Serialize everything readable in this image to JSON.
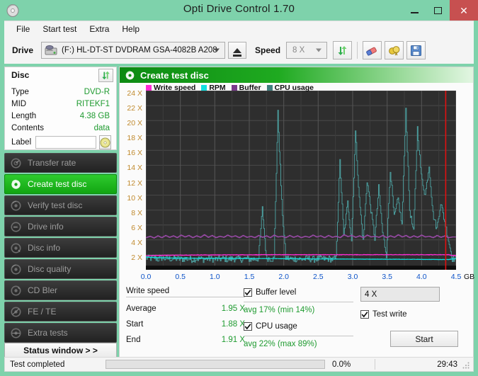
{
  "window": {
    "title": "Opti Drive Control 1.70",
    "app_icon": "disc-icon",
    "minimize_label": "",
    "maximize_label": "",
    "close_label": "✕"
  },
  "menu": {
    "items": [
      {
        "label": "File"
      },
      {
        "label": "Start test"
      },
      {
        "label": "Extra"
      },
      {
        "label": "Help"
      }
    ]
  },
  "toolbar": {
    "drive_label": "Drive",
    "drive_value": "(F:)   HL-DT-ST DVDRAM GSA-4082B A208",
    "eject_label": "eject-icon",
    "speed_label": "Speed",
    "speed_value": "8 X",
    "refresh_icon": "refresh-icon",
    "erase_icon": "eraser-icon",
    "medal_icon": "medal-icon",
    "save_icon": "floppy-save-icon"
  },
  "disc_panel": {
    "header": "Disc",
    "refresh_icon": "refresh-icon",
    "rows": [
      {
        "key": "Type",
        "value": "DVD-R"
      },
      {
        "key": "MID",
        "value": "RITEKF1"
      },
      {
        "key": "Length",
        "value": "4.38 GB"
      },
      {
        "key": "Contents",
        "value": "data"
      }
    ],
    "label_key": "Label",
    "label_value": "",
    "label_placeholder": "",
    "cd_icon": "cd-disc-icon"
  },
  "sidebar": {
    "items": [
      {
        "label": "Transfer rate",
        "icon": "gauge-icon",
        "active": false
      },
      {
        "label": "Create test disc",
        "icon": "disc-write-icon",
        "active": true
      },
      {
        "label": "Verify test disc",
        "icon": "disc-verify-icon",
        "active": false
      },
      {
        "label": "Drive info",
        "icon": "drive-info-icon",
        "active": false
      },
      {
        "label": "Disc info",
        "icon": "disc-info-icon",
        "active": false
      },
      {
        "label": "Disc quality",
        "icon": "disc-quality-icon",
        "active": false
      },
      {
        "label": "CD Bler",
        "icon": "cd-bler-icon",
        "active": false
      },
      {
        "label": "FE / TE",
        "icon": "fe-te-icon",
        "active": false
      },
      {
        "label": "Extra tests",
        "icon": "extra-tests-icon",
        "active": false
      }
    ],
    "status_window_label": "Status window > >"
  },
  "panel": {
    "title": "Create test disc",
    "icon": "disc-write-icon"
  },
  "chart_data": {
    "type": "line",
    "title": "Create test disc",
    "xlabel": "GB",
    "ylabel": "X",
    "xlim": [
      0.0,
      4.5
    ],
    "ylim": [
      0,
      24
    ],
    "grid": true,
    "legend_position": "top-left",
    "x_ticks": [
      "0.0",
      "0.5",
      "1.0",
      "1.5",
      "2.0",
      "2.5",
      "3.0",
      "3.5",
      "4.0",
      "4.5"
    ],
    "x_unit": "GB",
    "y_ticks": [
      "2 X",
      "4 X",
      "6 X",
      "8 X",
      "10 X",
      "12 X",
      "14 X",
      "16 X",
      "18 X",
      "20 X",
      "22 X",
      "24 X"
    ],
    "marker_x": 4.35,
    "marker_color": "#e01010",
    "series": [
      {
        "name": "Write speed",
        "color": "#ff2ad4",
        "values": [
          1.88,
          1.9,
          1.92,
          1.93,
          1.94,
          1.95,
          1.95,
          1.96,
          1.96,
          1.96,
          1.97,
          1.97,
          1.97,
          1.98,
          1.98,
          1.98,
          1.98,
          1.99,
          1.99,
          1.99,
          2.0,
          2.0,
          2.0,
          2.0,
          2.0,
          2.01,
          2.01,
          2.01,
          2.01,
          2.01,
          2.01,
          2.02,
          2.02,
          2.02,
          2.02,
          2.02,
          2.02,
          2.02,
          2.02,
          2.02,
          2.02,
          2.02,
          2.02,
          2.02,
          2.02,
          2.02,
          2.02,
          2.02,
          2.02,
          2.02,
          2.02,
          2.02,
          2.02,
          2.02,
          2.02,
          2.02,
          2.02,
          2.02,
          2.02,
          2.02,
          2.02,
          2.02,
          2.02,
          2.02,
          2.02,
          2.02,
          2.02,
          2.02,
          2.02,
          2.02,
          2.02,
          2.02,
          2.02,
          2.02,
          2.02,
          2.02,
          2.02,
          2.02,
          2.02,
          1.91
        ]
      },
      {
        "name": "RPM",
        "color": "#12e0e0",
        "values": [
          1.72,
          1.66,
          1.64,
          1.62,
          1.6,
          1.6,
          1.58,
          1.58,
          1.57,
          1.57,
          1.56,
          1.56,
          1.56,
          1.55,
          1.55,
          1.55,
          1.54,
          1.54,
          1.54,
          1.53,
          1.53,
          1.53,
          1.52,
          1.52,
          1.52,
          1.51,
          1.51,
          1.51,
          1.5,
          1.5,
          1.5,
          1.5,
          1.49,
          1.49,
          1.49,
          1.48,
          1.48,
          1.48,
          1.48,
          1.47,
          1.47,
          1.47,
          1.46,
          1.46,
          1.46,
          1.46,
          1.45,
          1.45,
          1.45,
          1.45,
          1.44,
          1.44,
          1.44,
          1.44,
          1.43,
          1.43,
          1.43,
          1.43,
          1.42,
          1.42,
          1.42,
          1.42,
          1.41,
          1.41,
          1.41,
          1.41,
          1.4,
          1.4,
          1.4,
          1.4,
          1.4,
          1.39,
          1.39,
          1.39,
          1.39,
          1.38,
          1.38,
          1.38,
          1.38,
          1.46
        ]
      },
      {
        "name": "Buffer",
        "color": "#9a4aa8",
        "values": [
          4.3,
          4.5,
          4.25,
          4.55,
          4.3,
          4.6,
          4.35,
          4.55,
          4.3,
          4.65,
          4.4,
          4.6,
          4.3,
          4.55,
          4.35,
          4.7,
          4.35,
          4.6,
          4.3,
          4.5,
          4.35,
          4.65,
          4.4,
          4.55,
          4.3,
          4.6,
          4.35,
          4.5,
          4.3,
          4.6,
          4.35,
          4.55,
          4.3,
          4.65,
          4.4,
          4.5,
          4.3,
          4.6,
          4.35,
          4.55,
          4.3,
          4.5,
          4.35,
          4.65,
          4.4,
          4.55,
          4.3,
          4.6,
          4.35,
          4.5,
          4.3,
          4.7,
          4.45,
          4.6,
          4.35,
          4.55,
          4.3,
          4.65,
          4.4,
          4.5,
          4.35,
          4.6,
          4.3,
          4.55,
          4.35,
          4.7,
          4.4,
          4.6,
          4.3,
          4.55,
          4.35,
          4.65,
          4.4,
          4.5,
          4.3,
          4.6,
          4.35,
          4.55,
          4.3,
          4.4
        ]
      },
      {
        "name": "CPU usage",
        "color": "#4a9a9a",
        "values": [
          1.6,
          1.5,
          1.7,
          1.4,
          1.6,
          1.5,
          1.5,
          1.45,
          1.5,
          1.4,
          1.5,
          1.45,
          1.4,
          1.5,
          1.45,
          1.4,
          1.5,
          1.45,
          1.4,
          1.45,
          1.5,
          1.4,
          1.45,
          1.5,
          1.4,
          1.45,
          1.5,
          1.4,
          1.45,
          1.5,
          8.2,
          1.6,
          1.5,
          1.45,
          21.0,
          9.0,
          1.6,
          1.5,
          1.45,
          1.5,
          1.4,
          1.45,
          1.5,
          1.4,
          1.45,
          1.5,
          1.45,
          1.5,
          1.4,
          1.5,
          14.5,
          4.5,
          9.0,
          4.0,
          18.5,
          9.5,
          3.8,
          12.0,
          8.0,
          4.2,
          11.0,
          5.0,
          2.0,
          13.5,
          7.0,
          9.5,
          6.0,
          21.5,
          8.0,
          5.0,
          19.0,
          12.5,
          10.0,
          14.0,
          7.5,
          5.5,
          9.0,
          6.5,
          4.0,
          1.5
        ]
      }
    ]
  },
  "write_speed_stats": {
    "title": "Write speed",
    "rows": [
      {
        "key": "Average",
        "value": "1.95 X"
      },
      {
        "key": "Start",
        "value": "1.88 X"
      },
      {
        "key": "End",
        "value": "1.91 X"
      }
    ]
  },
  "options": {
    "buffer_level_label": "Buffer level",
    "buffer_level_checked": true,
    "buffer_level_stat": "avg 17% (min 14%)",
    "cpu_usage_label": "CPU usage",
    "cpu_usage_checked": true,
    "cpu_usage_stat": "avg 22% (max 89%)",
    "speed_value": "4 X",
    "test_write_label": "Test write",
    "test_write_checked": true,
    "start_button_label": "Start"
  },
  "statusbar": {
    "message": "Test completed",
    "progress_percent": "0.0%",
    "progress_value": 0,
    "elapsed": "29:43"
  },
  "colors": {
    "window_chrome": "#7ed2ab",
    "close_button": "#c75050",
    "accent_green": "#1faa20",
    "value_green": "#1f9b30",
    "plot_background": "#2e2e2e",
    "y_axis_text": "#c08a2e",
    "x_axis_text": "#0d53c8"
  }
}
